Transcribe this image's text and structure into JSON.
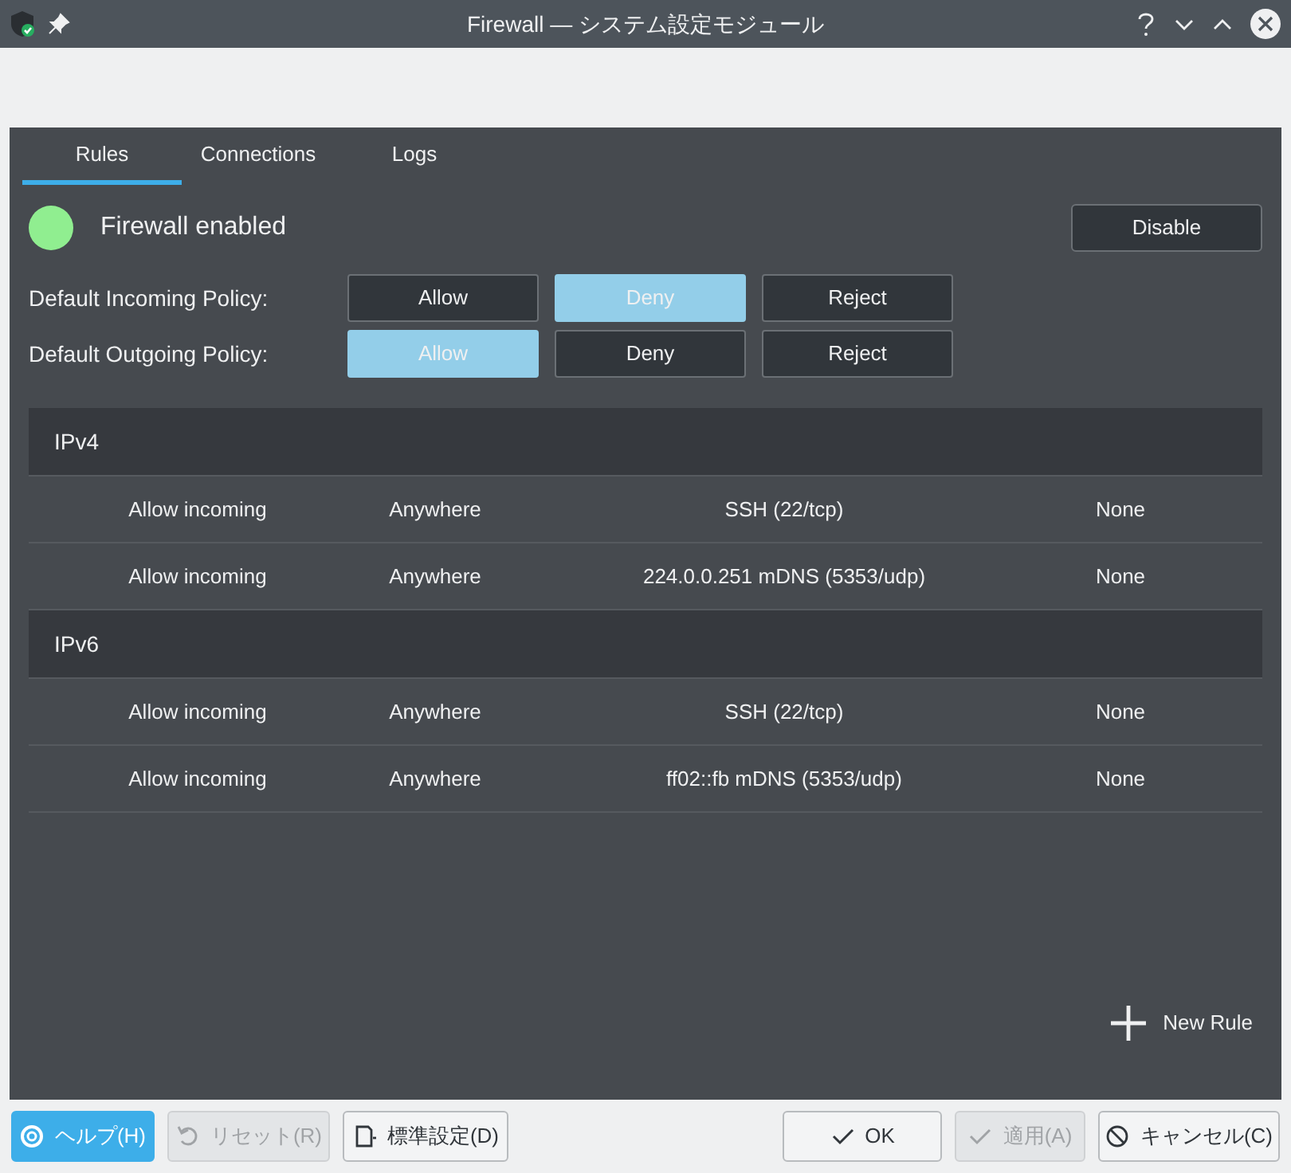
{
  "window": {
    "title": "Firewall — システム設定モジュール"
  },
  "tabs": [
    {
      "label": "Rules",
      "selected": true
    },
    {
      "label": "Connections",
      "selected": false
    },
    {
      "label": "Logs",
      "selected": false
    }
  ],
  "status": {
    "label": "Firewall enabled",
    "enabled": true,
    "button": "Disable"
  },
  "policies": [
    {
      "label": "Default Incoming Policy:",
      "options": [
        {
          "label": "Allow",
          "selected": false
        },
        {
          "label": "Deny",
          "selected": true
        },
        {
          "label": "Reject",
          "selected": false
        }
      ]
    },
    {
      "label": "Default Outgoing Policy:",
      "options": [
        {
          "label": "Allow",
          "selected": true
        },
        {
          "label": "Deny",
          "selected": false
        },
        {
          "label": "Reject",
          "selected": false
        }
      ]
    }
  ],
  "sections": [
    {
      "title": "IPv4",
      "rules": [
        {
          "column_1": "Allow incoming",
          "column_2": "Anywhere",
          "column_3": "SSH (22/tcp)",
          "column_4": "None"
        },
        {
          "column_1": "Allow incoming",
          "column_2": "Anywhere",
          "column_3": "224.0.0.251 mDNS (5353/udp)",
          "column_4": "None"
        }
      ]
    },
    {
      "title": "IPv6",
      "rules": [
        {
          "column_1": "Allow incoming",
          "column_2": "Anywhere",
          "column_3": "SSH (22/tcp)",
          "column_4": "None"
        },
        {
          "column_1": "Allow incoming",
          "column_2": "Anywhere",
          "column_3": "ff02::fb mDNS (5353/udp)",
          "column_4": "None"
        }
      ]
    }
  ],
  "new_rule": "New Rule",
  "buttons": [
    {
      "kind": "help",
      "label": "ヘルプ(H)",
      "highlighted": true,
      "disabled": false
    },
    {
      "kind": "reset",
      "label": "リセット(R)",
      "highlighted": false,
      "disabled": true
    },
    {
      "kind": "defaults",
      "label": "標準設定(D)",
      "highlighted": false,
      "disabled": false
    },
    {
      "kind": "ok",
      "label": "OK",
      "highlighted": false,
      "disabled": false
    },
    {
      "kind": "apply",
      "label": "適用(A)",
      "highlighted": false,
      "disabled": true
    },
    {
      "kind": "cancel",
      "label": "キャンセル(C)",
      "highlighted": false,
      "disabled": false
    }
  ]
}
